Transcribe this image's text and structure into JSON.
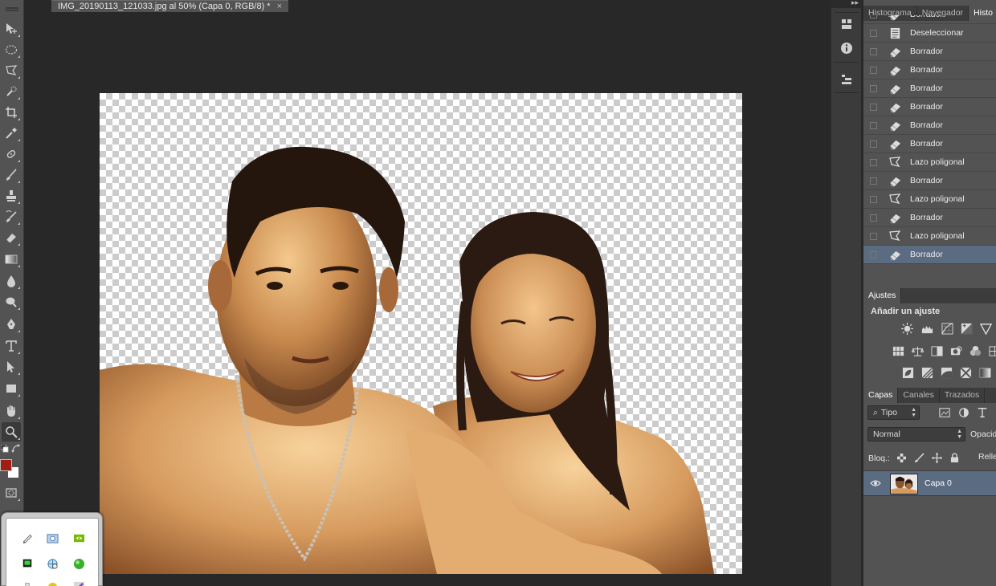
{
  "document": {
    "tab_title": "IMG_20190113_121033.jpg al 50% (Capa 0, RGB/8) *",
    "close_glyph": "×"
  },
  "toolbar": {
    "tools": [
      "move-tool",
      "elliptical-marquee-tool",
      "polygonal-lasso-tool",
      "quick-selection-tool",
      "crop-tool",
      "eyedropper-tool",
      "spot-healing-brush-tool",
      "brush-tool",
      "clone-stamp-tool",
      "history-brush-tool",
      "eraser-tool",
      "gradient-tool",
      "blur-tool",
      "dodge-tool",
      "pen-tool",
      "type-tool",
      "path-selection-tool",
      "rectangle-tool",
      "hand-tool",
      "zoom-tool"
    ],
    "foreground_color": "#a11e14",
    "background_color": "#ffffff"
  },
  "history_panel": {
    "tabs": [
      "Histograma",
      "Navegador",
      "Histo"
    ],
    "active_tab": "Histo",
    "items": [
      {
        "label": "Borrador",
        "icon": "eraser-icon"
      },
      {
        "label": "Deseleccionar",
        "icon": "document-icon"
      },
      {
        "label": "Borrador",
        "icon": "eraser-icon"
      },
      {
        "label": "Borrador",
        "icon": "eraser-icon"
      },
      {
        "label": "Borrador",
        "icon": "eraser-icon"
      },
      {
        "label": "Borrador",
        "icon": "eraser-icon"
      },
      {
        "label": "Borrador",
        "icon": "eraser-icon"
      },
      {
        "label": "Borrador",
        "icon": "eraser-icon"
      },
      {
        "label": "Lazo poligonal",
        "icon": "polygonal-lasso-icon"
      },
      {
        "label": "Borrador",
        "icon": "eraser-icon"
      },
      {
        "label": "Lazo poligonal",
        "icon": "polygonal-lasso-icon"
      },
      {
        "label": "Borrador",
        "icon": "eraser-icon"
      },
      {
        "label": "Lazo poligonal",
        "icon": "polygonal-lasso-icon"
      },
      {
        "label": "Borrador",
        "icon": "eraser-icon",
        "selected": true
      }
    ]
  },
  "adjustments_panel": {
    "tab": "Ajustes",
    "title": "Añadir un ajuste"
  },
  "layers_panel": {
    "tabs": [
      "Capas",
      "Canales",
      "Trazados"
    ],
    "active_tab": "Capas",
    "filter_kind": "Tipo",
    "blend_mode": "Normal",
    "opacity_label": "Opacid",
    "lock_label": "Bloq.:",
    "fill_label": "Relle",
    "layers": [
      {
        "name": "Capa 0",
        "visible": true,
        "selected": true
      }
    ]
  },
  "accent_colors": {
    "selection": "#5b6b82",
    "panel": "#535353",
    "workspace": "#282828"
  }
}
